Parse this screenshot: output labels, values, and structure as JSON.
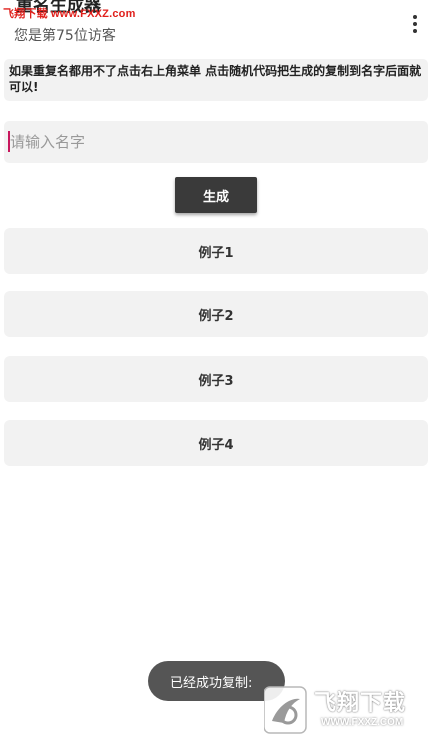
{
  "watermark": {
    "top_text": "飞翔下载 www.FXXZ.com",
    "bottom_title": "飞翔下载",
    "bottom_url": "WWW.FXXZ.COM"
  },
  "header": {
    "title": "重名生成器",
    "subtitle": "您是第75位访客",
    "menu_icon": "more-vertical-icon"
  },
  "notice": {
    "text": "如果重复名都用不了点击右上角菜单 点击随机代码把生成的复制到名字后面就可以!"
  },
  "name_input": {
    "value": "",
    "placeholder": "请输入名字"
  },
  "generate_button": {
    "label": "生成"
  },
  "examples": [
    {
      "label": "例子1"
    },
    {
      "label": "例子2"
    },
    {
      "label": "例子3"
    },
    {
      "label": "例子4"
    }
  ],
  "toast": {
    "text": "已经成功复制:"
  },
  "colors": {
    "background": "#ffffff",
    "card": "#f2f2f2",
    "button": "#3a3a3a",
    "toast": "#555555",
    "caret": "#c8175d",
    "watermark_red": "#e0201c"
  }
}
